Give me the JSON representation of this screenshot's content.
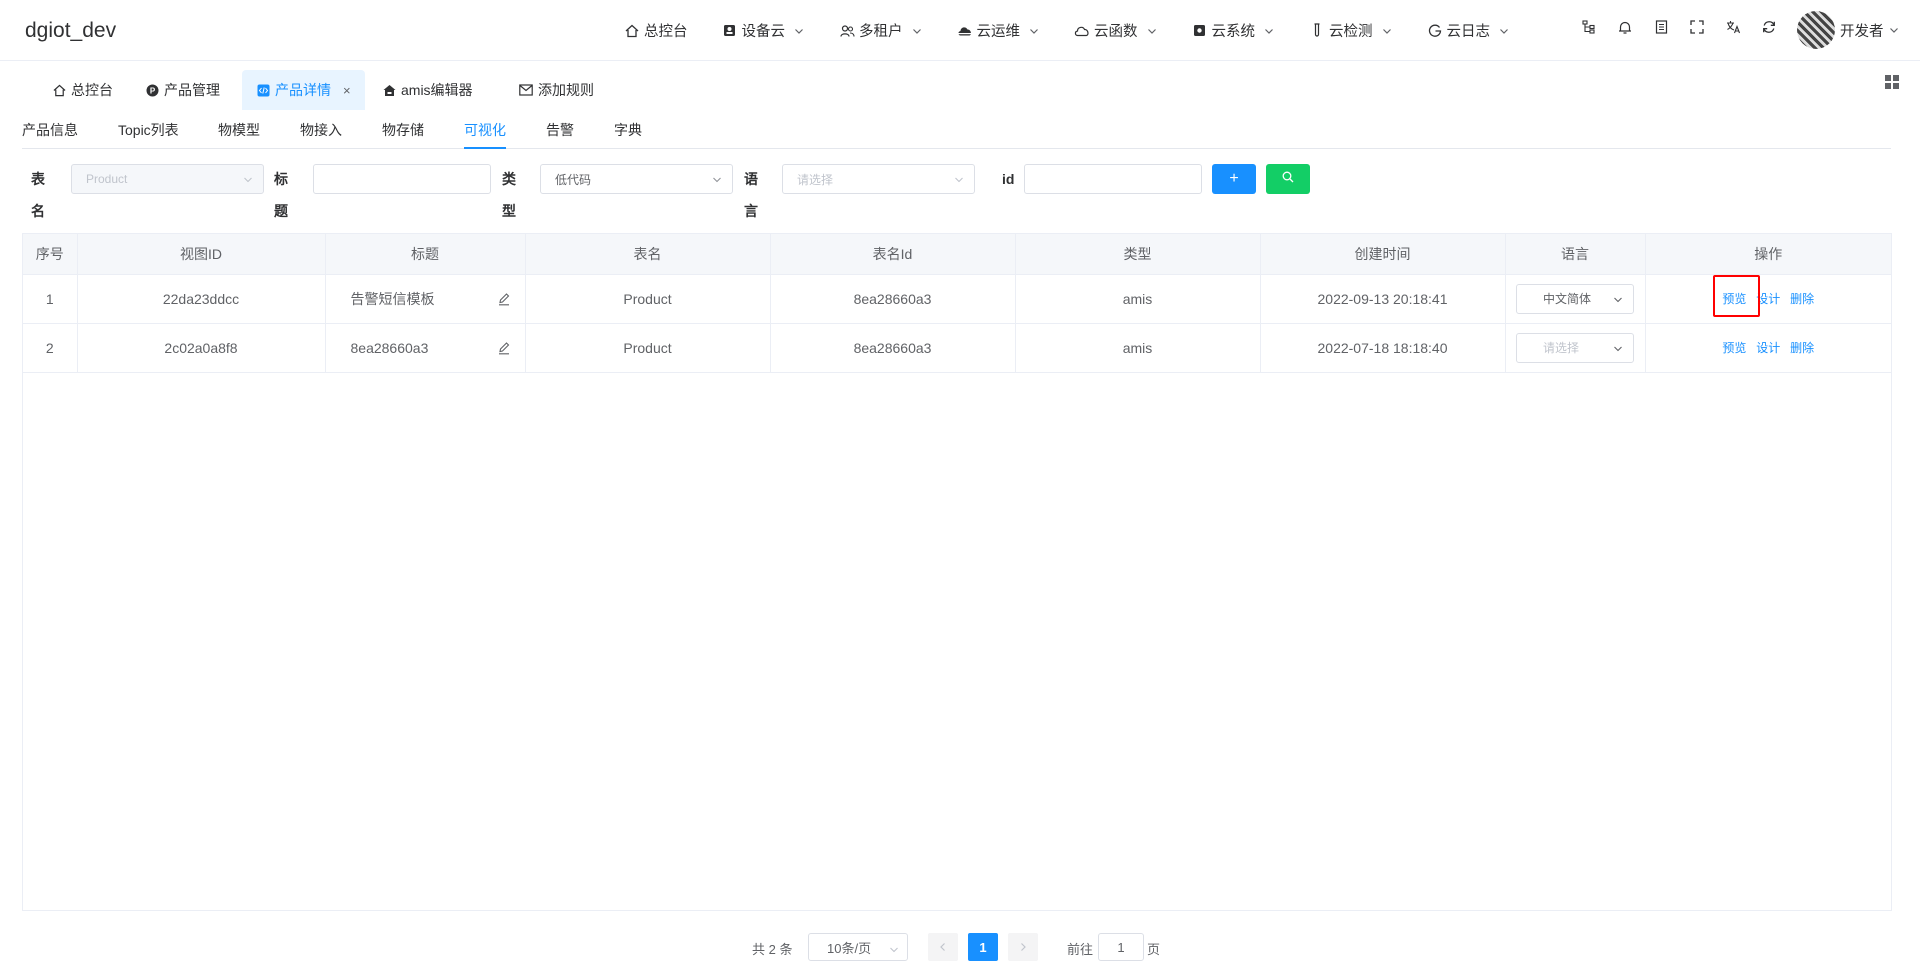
{
  "app": {
    "title": "dgiot_dev"
  },
  "top_nav": [
    {
      "label": "总控台",
      "icon": "home-icon",
      "has_dropdown": false
    },
    {
      "label": "设备云",
      "icon": "device-icon",
      "has_dropdown": true
    },
    {
      "label": "多租户",
      "icon": "users-icon",
      "has_dropdown": true
    },
    {
      "label": "云运维",
      "icon": "cloud-solid-icon",
      "has_dropdown": true
    },
    {
      "label": "云函数",
      "icon": "cloud-icon",
      "has_dropdown": true
    },
    {
      "label": "云系统",
      "icon": "system-icon",
      "has_dropdown": true
    },
    {
      "label": "云检测",
      "icon": "test-tube-icon",
      "has_dropdown": true
    },
    {
      "label": "云日志",
      "icon": "log-icon",
      "has_dropdown": true
    }
  ],
  "user": {
    "name": "开发者"
  },
  "tabs": [
    {
      "label": "总控台",
      "active": false
    },
    {
      "label": "产品管理",
      "active": false
    },
    {
      "label": "产品详情",
      "active": true,
      "close": "×"
    },
    {
      "label": "amis编辑器",
      "active": false
    },
    {
      "label": "添加规则",
      "active": false
    }
  ],
  "subtabs": [
    {
      "label": "产品信息",
      "active": false
    },
    {
      "label": "Topic列表",
      "active": false
    },
    {
      "label": "物模型",
      "active": false
    },
    {
      "label": "物接入",
      "active": false
    },
    {
      "label": "物存储",
      "active": false
    },
    {
      "label": "可视化",
      "active": true
    },
    {
      "label": "告警",
      "active": false
    },
    {
      "label": "字典",
      "active": false
    }
  ],
  "filters": {
    "table_label": "表名",
    "table_value": "Product",
    "title_label": "标题",
    "title_value": "",
    "type_label": "类型",
    "type_value": "低代码",
    "lang_label": "语言",
    "lang_placeholder": "请选择",
    "id_label": "id",
    "id_value": "",
    "add_button": "+",
    "search_button": "search"
  },
  "table": {
    "columns": [
      "序号",
      "视图ID",
      "标题",
      "表名",
      "表名Id",
      "类型",
      "创建时间",
      "语言",
      "操作"
    ],
    "rows": [
      {
        "index": "1",
        "view_id": "22da23ddcc",
        "title": "告警短信模板",
        "table": "Product",
        "table_id": "8ea28660a3",
        "type": "amis",
        "created": "2022-09-13 20:18:41",
        "lang": "中文简体",
        "lang_is_placeholder": false
      },
      {
        "index": "2",
        "view_id": "2c02a0a8f8",
        "title": "8ea28660a3",
        "table": "Product",
        "table_id": "8ea28660a3",
        "type": "amis",
        "created": "2022-07-18 18:18:40",
        "lang": "请选择",
        "lang_is_placeholder": true
      }
    ],
    "actions": {
      "preview": "预览",
      "design": "设计",
      "delete": "删除"
    }
  },
  "pagination": {
    "total": "共 2 条",
    "page_size": "10条/页",
    "current_page": "1",
    "goto_label": "前往",
    "goto_value": "1",
    "page_suffix": "页"
  },
  "colors": {
    "primary": "#1890ff",
    "success": "#13ce66",
    "highlight": "#ff0000"
  }
}
